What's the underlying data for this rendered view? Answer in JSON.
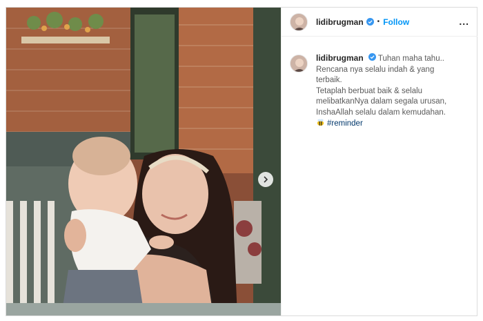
{
  "post": {
    "username": "lidibrugman",
    "dot": "•",
    "follow_label": "Follow",
    "more_label": "...",
    "caption": {
      "username": "lidibrugman",
      "first_line": "Tuhan maha tahu..",
      "lines": [
        "Rencana nya selalu indah & yang",
        "terbaik.",
        "Tetaplah berbuat baik & selalu",
        "melibatkanNya dalam segala urusan,",
        "InshaAllah selalu dalam kemudahan."
      ],
      "hashtag": "#reminder"
    }
  },
  "colors": {
    "link": "#0095f6",
    "hashtag": "#00376b",
    "verified": "#3897f0"
  },
  "icons": {
    "verified": "verified-badge-icon",
    "carousel": "chevron-right-icon",
    "emoji": "bee-emoji-icon"
  }
}
